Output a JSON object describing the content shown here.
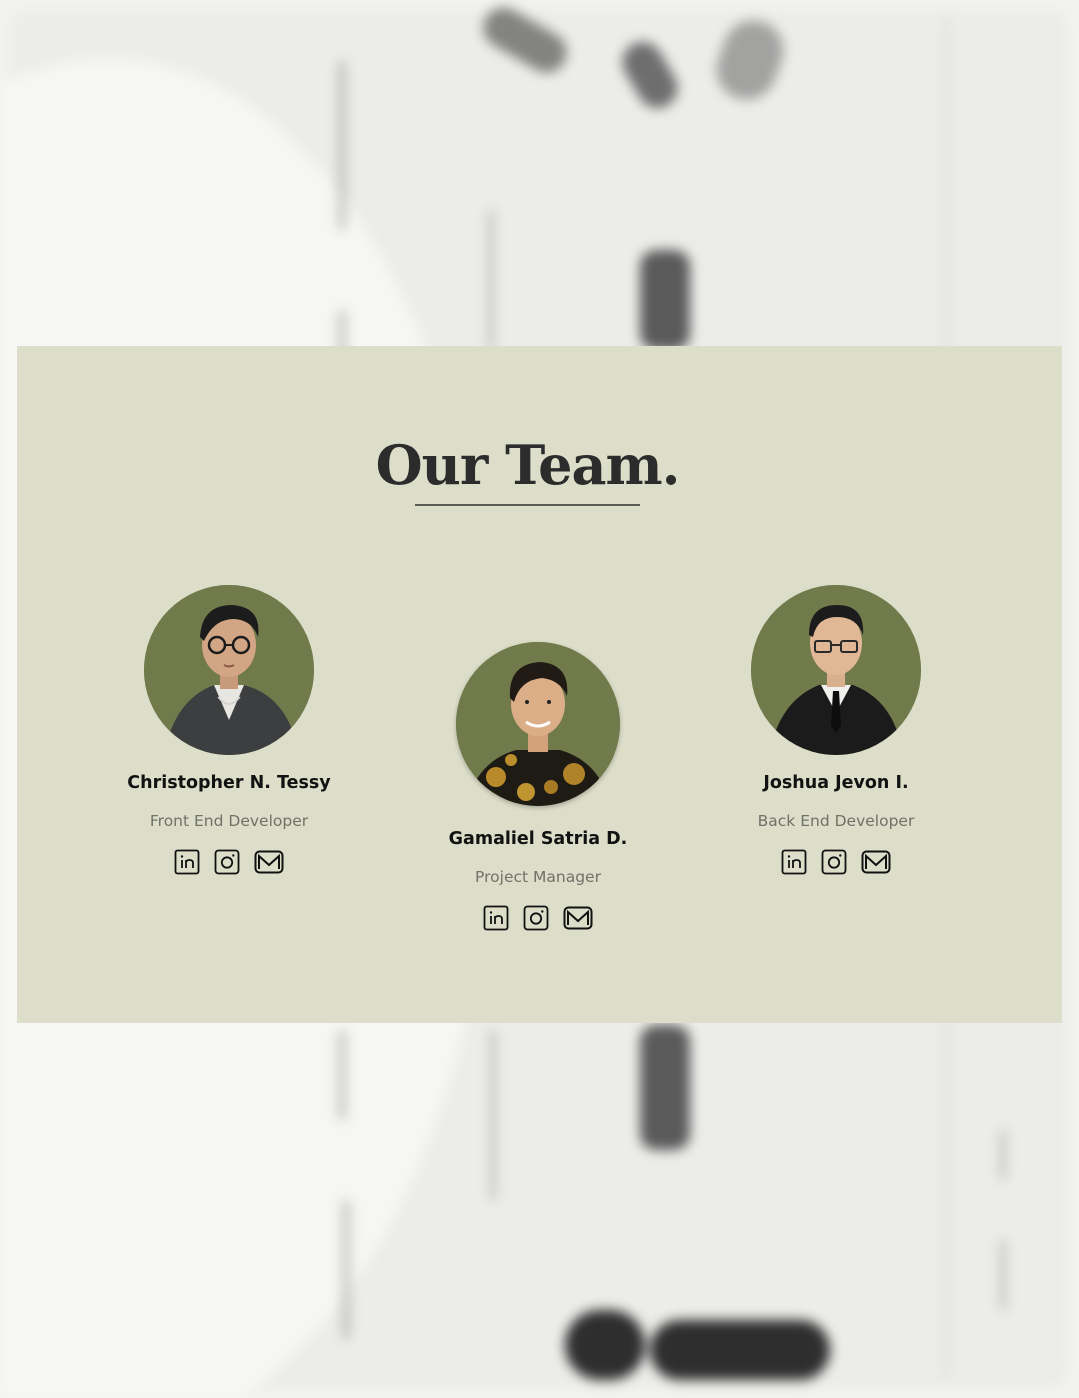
{
  "section": {
    "title": "Our Team."
  },
  "members": [
    {
      "name": "Christopher N. Tessy",
      "role": "Front End Developer",
      "socials": [
        "linkedin-icon",
        "instagram-icon",
        "mail-icon"
      ]
    },
    {
      "name": "Gamaliel Satria D.",
      "role": "Project Manager",
      "socials": [
        "linkedin-icon",
        "instagram-icon",
        "mail-icon"
      ]
    },
    {
      "name": "Joshua Jevon I.",
      "role": "Back End Developer",
      "socials": [
        "linkedin-icon",
        "instagram-icon",
        "mail-icon"
      ]
    }
  ],
  "colors": {
    "section_bg": "#dcdec9",
    "avatar_bg": "#707a4a",
    "title": "#2c2c2c",
    "role_text": "#717168"
  }
}
